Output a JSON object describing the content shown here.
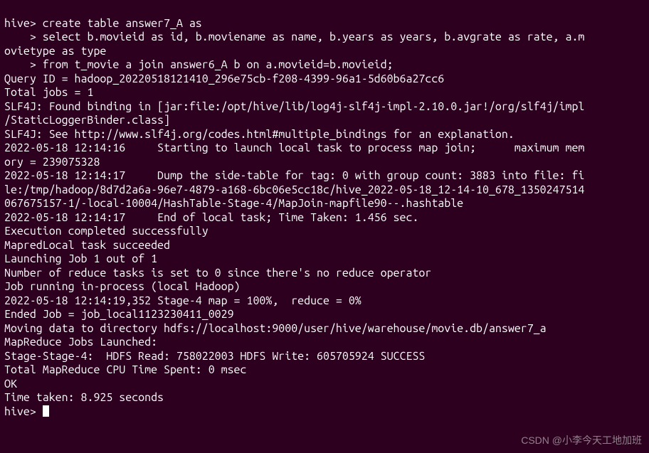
{
  "terminal": {
    "lines": [
      "hive> create table answer7_A as",
      "    > select b.movieid as id, b.moviename as name, b.years as years, b.avgrate as rate, a.m",
      "ovietype as type",
      "    > from t_movie a join answer6_A b on a.movieid=b.movieid;",
      "Query ID = hadoop_20220518121410_296e75cb-f208-4399-96a1-5d60b6a27cc6",
      "Total jobs = 1",
      "SLF4J: Found binding in [jar:file:/opt/hive/lib/log4j-slf4j-impl-2.10.0.jar!/org/slf4j/impl",
      "/StaticLoggerBinder.class]",
      "SLF4J: See http://www.slf4j.org/codes.html#multiple_bindings for an explanation.",
      "2022-05-18 12:14:16     Starting to launch local task to process map join;      maximum mem",
      "ory = 239075328",
      "2022-05-18 12:14:17     Dump the side-table for tag: 0 with group count: 3883 into file: fi",
      "le:/tmp/hadoop/8d7d2a6a-96e7-4879-a168-6bc06e5cc18c/hive_2022-05-18_12-14-10_678_1350247514",
      "067675157-1/-local-10004/HashTable-Stage-4/MapJoin-mapfile90--.hashtable",
      "2022-05-18 12:14:17     End of local task; Time Taken: 1.456 sec.",
      "Execution completed successfully",
      "MapredLocal task succeeded",
      "Launching Job 1 out of 1",
      "Number of reduce tasks is set to 0 since there's no reduce operator",
      "Job running in-process (local Hadoop)",
      "2022-05-18 12:14:19,352 Stage-4 map = 100%,  reduce = 0%",
      "Ended Job = job_local1123230411_0029",
      "Moving data to directory hdfs://localhost:9000/user/hive/warehouse/movie.db/answer7_a",
      "MapReduce Jobs Launched:",
      "Stage-Stage-4:  HDFS Read: 758022003 HDFS Write: 605705924 SUCCESS",
      "Total MapReduce CPU Time Spent: 0 msec",
      "OK",
      "Time taken: 8.925 seconds",
      "hive> "
    ]
  },
  "watermark": {
    "text": "CSDN @小李今天工地加班"
  }
}
